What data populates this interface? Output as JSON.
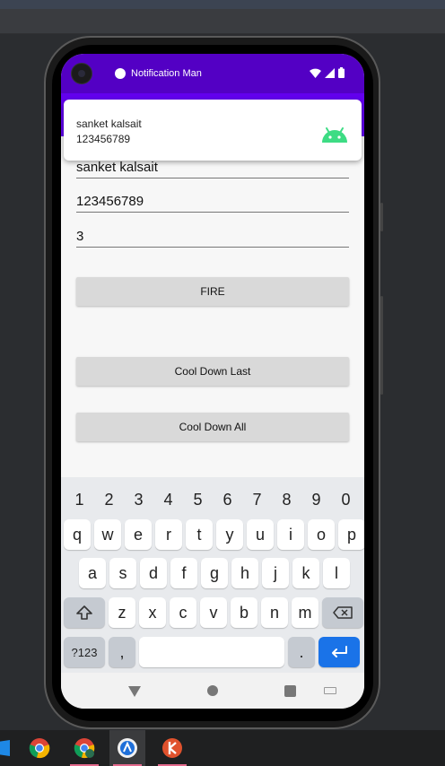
{
  "status_bar": {
    "notification_title": "Notification Man"
  },
  "notification": {
    "title": "sanket kalsait",
    "text": "123456789"
  },
  "form": {
    "name_value": "sanket kalsait",
    "phone_value": "123456789",
    "count_value": "3"
  },
  "buttons": {
    "fire": "FIRE",
    "cool_down_last": "Cool Down Last",
    "cool_down_all": "Cool Down All"
  },
  "keyboard": {
    "numbers": [
      "1",
      "2",
      "3",
      "4",
      "5",
      "6",
      "7",
      "8",
      "9",
      "0"
    ],
    "row1": [
      "q",
      "w",
      "e",
      "r",
      "t",
      "y",
      "u",
      "i",
      "o",
      "p"
    ],
    "row2": [
      "a",
      "s",
      "d",
      "f",
      "g",
      "h",
      "j",
      "k",
      "l"
    ],
    "row3": [
      "z",
      "x",
      "c",
      "v",
      "b",
      "n",
      "m"
    ],
    "symbols_label": "?123",
    "comma": ",",
    "period": "."
  },
  "colors": {
    "primary": "#6200ee",
    "status_bar": "#5300c4",
    "enter_key": "#1a73e8"
  }
}
